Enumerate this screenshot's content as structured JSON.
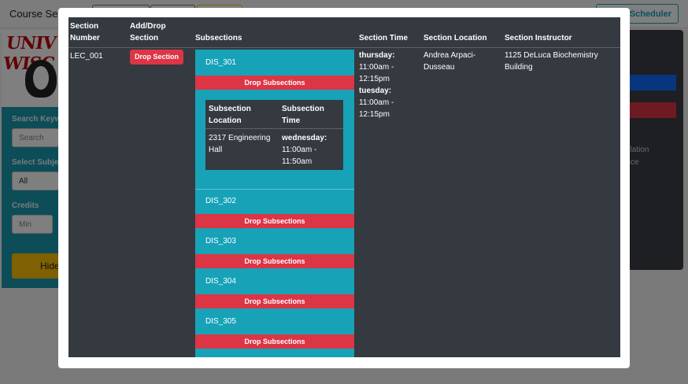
{
  "background": {
    "app_title": "Course Sel",
    "scheduler_button": "Scheduler",
    "logo_text": "UNIV WISC",
    "search_label": "Search Keyw",
    "search_placeholder": "Search",
    "subject_label": "Select Subje",
    "subject_value": "All",
    "credits_label": "Credits",
    "credits_placeholder": "Min",
    "hide_button": "Hide",
    "right_text_1": "nslation",
    "right_text_2": "ance"
  },
  "modal": {
    "headers": {
      "section_number": "Section Number",
      "add_drop": "Add/Drop Section",
      "subsections": "Subsections",
      "section_time": "Section Time",
      "section_location": "Section Location",
      "section_instructor": "Section Instructor"
    },
    "row": {
      "section_number": "LEC_001",
      "drop_section": "Drop Section",
      "time": [
        {
          "day": "thursday:",
          "range": "11:00am - 12:15pm"
        },
        {
          "day": "tuesday:",
          "range": "11:00am - 12:15pm"
        }
      ],
      "location": "Andrea Arpaci-Dusseau",
      "instructor": "1125 DeLuca Biochemistry Building"
    },
    "subsections": [
      {
        "name": "DIS_301",
        "drop": "Drop Subsections"
      },
      {
        "name": "DIS_302",
        "drop": "Drop Subsections"
      },
      {
        "name": "DIS_303",
        "drop": "Drop Subsections"
      },
      {
        "name": "DIS_304",
        "drop": "Drop Subsections"
      },
      {
        "name": "DIS_305",
        "drop": "Drop Subsections"
      }
    ],
    "detail": {
      "header_location": "Subsection Location",
      "header_time": "Subsection Time",
      "location": "2317 Engineering Hall",
      "day": "wednesday:",
      "range": "11:00am - 11:50am"
    }
  },
  "colors": {
    "teal": "#17a2b8",
    "red": "#dc3545",
    "dark": "#343a40"
  }
}
